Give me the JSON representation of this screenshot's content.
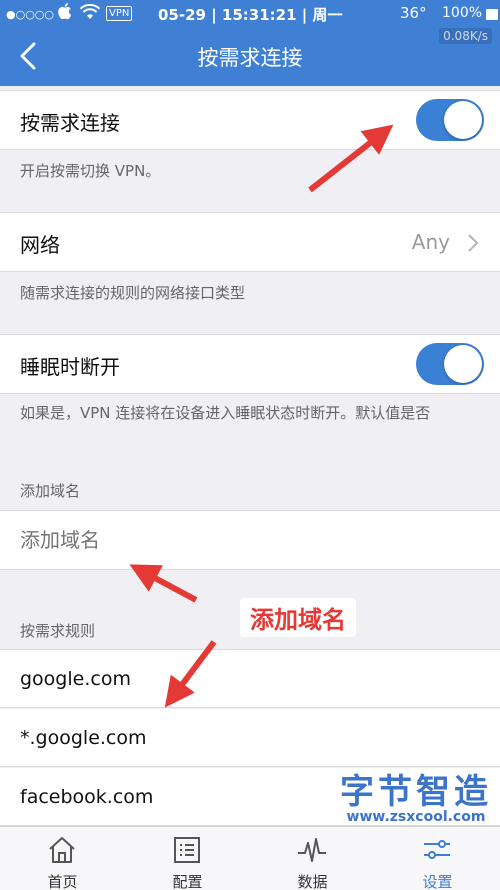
{
  "statusbar": {
    "signal": "●○○○○",
    "vpn_badge": "VPN",
    "datetime": "05-29 | 15:31:21 | 周一",
    "temp": "36°",
    "battery": "100%"
  },
  "nav": {
    "title": "按需求连接",
    "speed": "0.08K/s"
  },
  "settings": {
    "on_demand": {
      "label": "按需求连接",
      "on": true
    },
    "on_demand_note": "开启按需切换 VPN。",
    "network": {
      "label": "网络",
      "value": "Any"
    },
    "network_note": "随需求连接的规则的网络接口类型",
    "sleep": {
      "label": "睡眠时断开",
      "on": true
    },
    "sleep_note": "如果是，VPN 连接将在设备进入睡眠状态时断开。默认值是否",
    "add_domain_header": "添加域名",
    "add_domain_placeholder": "添加域名",
    "rules_header": "按需求规则",
    "rules": [
      "google.com",
      "*.google.com",
      "facebook.com"
    ]
  },
  "annotation": "添加域名",
  "watermark": {
    "title": "字节智造",
    "url": "www.zsxcool.com"
  },
  "tabbar": [
    {
      "label": "首页",
      "icon": "home-icon"
    },
    {
      "label": "配置",
      "icon": "list-icon"
    },
    {
      "label": "数据",
      "icon": "pulse-icon"
    },
    {
      "label": "设置",
      "icon": "sliders-icon"
    }
  ],
  "colors": {
    "accent": "#3f7fd4",
    "annotation": "#e53935"
  }
}
